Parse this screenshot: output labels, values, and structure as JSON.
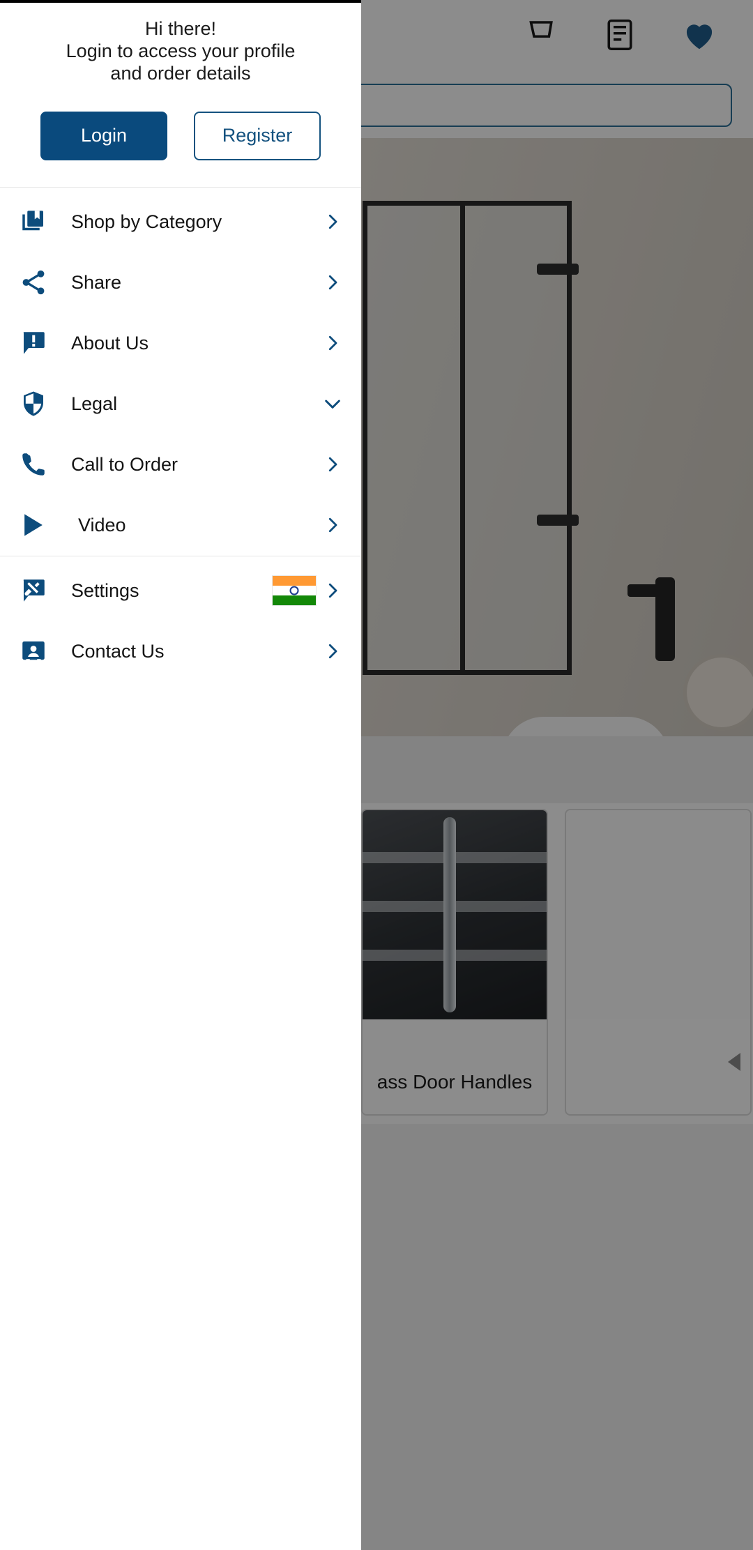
{
  "drawer": {
    "greeting": {
      "line1": "Hi there!",
      "line2": "Login to access your profile",
      "line3": "and order details"
    },
    "auth": {
      "login_label": "Login",
      "register_label": "Register"
    },
    "menu_primary": [
      {
        "label": "Shop by Category",
        "icon": "library-book-icon",
        "chevron": "chevron-right-icon"
      },
      {
        "label": "Share",
        "icon": "share-icon",
        "chevron": "chevron-right-icon"
      },
      {
        "label": "About Us",
        "icon": "info-bubble-icon",
        "chevron": "chevron-right-icon"
      },
      {
        "label": "Legal",
        "icon": "shield-icon",
        "chevron": "chevron-down-icon"
      },
      {
        "label": "Call to Order",
        "icon": "phone-icon",
        "chevron": "chevron-right-icon"
      },
      {
        "label": "Video",
        "icon": "play-icon",
        "chevron": "chevron-right-icon"
      }
    ],
    "menu_secondary": [
      {
        "label": "Settings",
        "icon": "settings-bubble-icon",
        "chevron": "chevron-right-icon",
        "flag": "india-flag-icon"
      },
      {
        "label": "Contact Us",
        "icon": "contact-card-icon",
        "chevron": "chevron-right-icon"
      }
    ],
    "colors": {
      "accent": "#0d4c7c",
      "login_bg": "#0a4a7d",
      "register_border": "#14527f",
      "text": "#141414"
    }
  },
  "background": {
    "toolbar_icons": [
      "cart-icon",
      "orders-icon",
      "wishlist-heart-icon"
    ],
    "search_placeholder": "",
    "product_card_label": "ass Door Handles"
  }
}
